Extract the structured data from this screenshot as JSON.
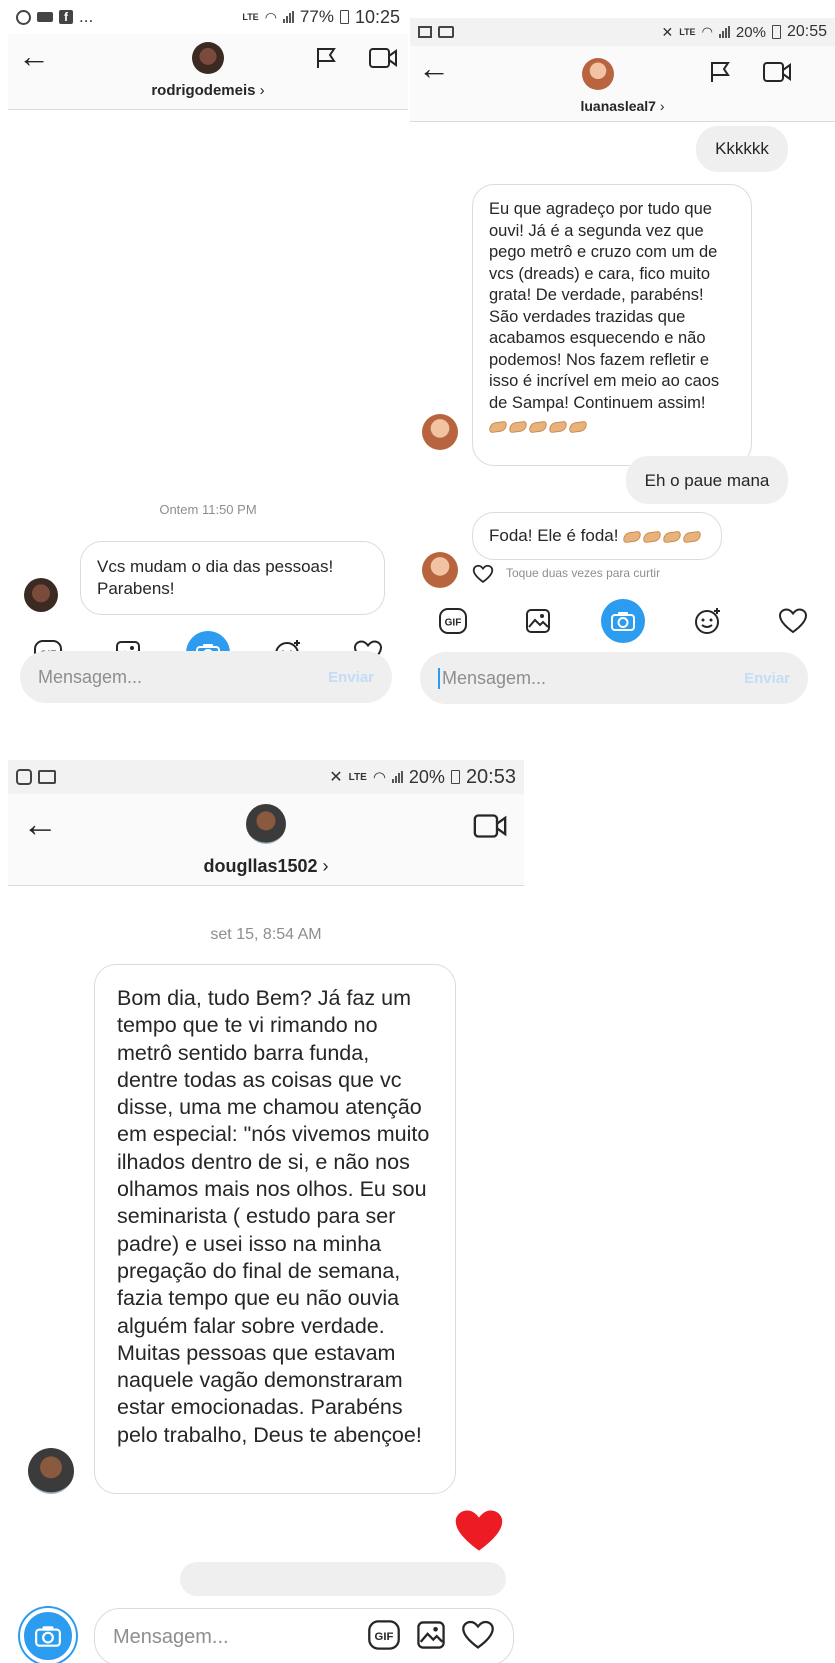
{
  "panel1": {
    "status": {
      "time": "10:25",
      "battery": "77%",
      "left_dots": "...",
      "net": "LTE"
    },
    "header": {
      "username": "rodrigodemeis",
      "chevron": "›"
    },
    "timestamp": "Ontem 11:50 PM",
    "message": "Vcs mudam o dia das pessoas! Parabens!",
    "input": {
      "placeholder": "Mensagem...",
      "send": "Enviar"
    },
    "tools": [
      "gif-icon",
      "image-icon",
      "camera-icon",
      "sticker-icon",
      "heart-icon"
    ]
  },
  "panel2": {
    "status": {
      "time": "20:55",
      "battery": "20%",
      "net": "LTE"
    },
    "header": {
      "username": "luanasleal7",
      "chevron": "›"
    },
    "messages": [
      {
        "from": "me",
        "text": "Kkkkkk"
      },
      {
        "from": "them",
        "text": "Eu que agradeço por tudo que ouvi! Já é a segunda vez que pego metrô e cruzo com um de vcs (dreads) e cara, fico muito grata! De verdade, parabéns! São verdades trazidas que acabamos esquecendo e não podemos! Nos fazem refletir e isso é incrível em meio ao caos de Sampa! Continuem assim!"
      },
      {
        "from": "me",
        "text": "Eh o paue mana"
      },
      {
        "from": "them",
        "text": "Foda! Ele é foda!"
      }
    ],
    "like_hint": "Toque duas vezes para curtir",
    "input": {
      "placeholder": "Mensagem...",
      "send": "Enviar"
    }
  },
  "panel3": {
    "status": {
      "time": "20:53",
      "battery": "20%",
      "net": "LTE"
    },
    "header": {
      "username": "dougllas1502",
      "chevron": "›"
    },
    "timestamp": "set 15, 8:54 AM",
    "message": "Bom dia, tudo Bem? Já faz um tempo que te vi rimando no metrô sentido barra funda, dentre todas as coisas que vc disse, uma me chamou atenção em especial: \"nós vivemos muito ilhados dentro de si, e não nos olhamos mais nos olhos. Eu sou seminarista ( estudo para ser padre) e usei isso na minha pregação do final de semana, fazia tempo que eu não ouvia alguém falar sobre verdade. Muitas pessoas que estavam naquele vagão demonstraram estar emocionadas. Parabéns pelo trabalho, Deus te abençoe!",
    "input": {
      "placeholder": "Mensagem..."
    }
  },
  "colors": {
    "accent": "#2c9cf0",
    "heart": "#ed1c24",
    "bubble_mine": "#efefef",
    "border": "#dbdbdb"
  }
}
